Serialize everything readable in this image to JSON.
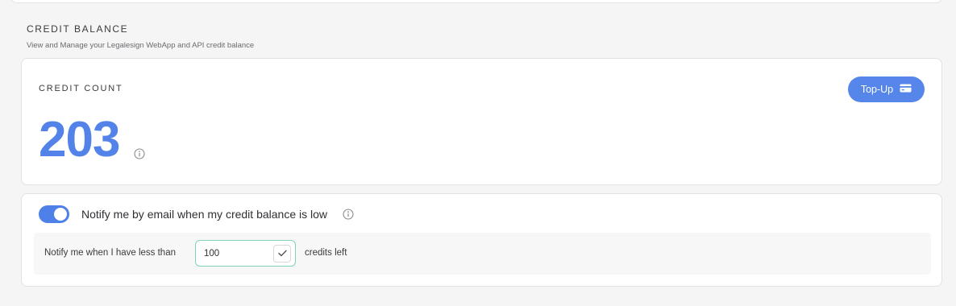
{
  "section": {
    "title": "CREDIT BALANCE",
    "subtitle": "View and Manage your Legalesign WebApp and API credit balance"
  },
  "credit_card": {
    "label": "CREDIT COUNT",
    "value": "203",
    "info_icon": "info-circle-icon",
    "topup_label": "Top-Up",
    "topup_icon": "credit-card-icon"
  },
  "notify": {
    "enabled": true,
    "label": "Notify me by email when my credit balance is low",
    "info_icon": "info-circle-icon",
    "threshold_prefix": "Notify me when I have less than",
    "threshold_value": "100",
    "threshold_suffix": "credits left",
    "confirm_icon": "checkmark-icon"
  },
  "colors": {
    "accent": "#5686ea",
    "valid_border": "#7fd4b3"
  }
}
